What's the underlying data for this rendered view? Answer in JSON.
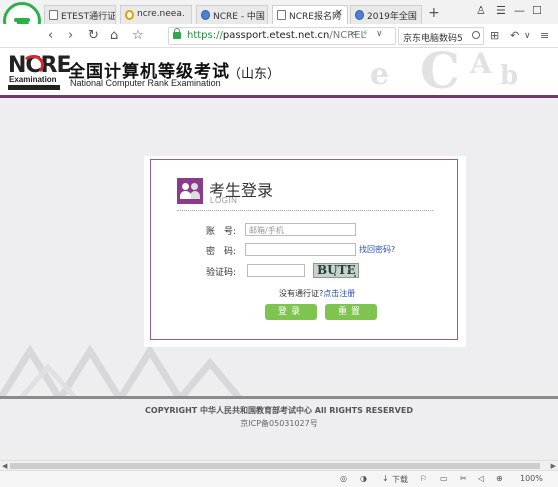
{
  "browser": {
    "tabs": [
      {
        "title": "ETEST通行证",
        "icon": "page-icon"
      },
      {
        "title": "ncre.neea.",
        "icon": "loading-icon"
      },
      {
        "title": "NCRE - 中国",
        "icon": "globe-icon"
      },
      {
        "title": "NCRE报名网",
        "icon": "page-icon",
        "active": true
      },
      {
        "title": "2019年全国",
        "icon": "globe-icon"
      }
    ],
    "new_tab": "+",
    "address": {
      "scheme": "https://",
      "domain": "passport.etest.net.cn",
      "path": "/NCREL"
    },
    "search_placeholder": "京东电脑数码5"
  },
  "header": {
    "logo_letters": "NCRE",
    "logo_exam": "Examination",
    "title": "全国计算机等级考试",
    "subtitle": "National Computer Rank Examination",
    "region": "（山东）"
  },
  "login": {
    "title": "考生登录",
    "subtitle": "LOGIN",
    "account_label": "账　号:",
    "account_placeholder": "邮箱/手机",
    "password_label": "密　码:",
    "forgot_link": "找回密码?",
    "captcha_label": "验证码:",
    "captcha_text": "BUTE",
    "no_account_text": "没有通行证?",
    "register_link": "点击注册",
    "login_button": "登录",
    "reset_button": "重置"
  },
  "footer": {
    "copyright": "COPYRIGHT 中华人民共和国教育部考试中心 All RIGHTS RESERVED",
    "icp": "京ICP备05031027号"
  },
  "statusbar": {
    "download": "下载",
    "zoom": "100%"
  },
  "colors": {
    "accent_purple": "#6e3a67",
    "button_green": "#7fc450",
    "browser_green": "#2bb04a"
  }
}
